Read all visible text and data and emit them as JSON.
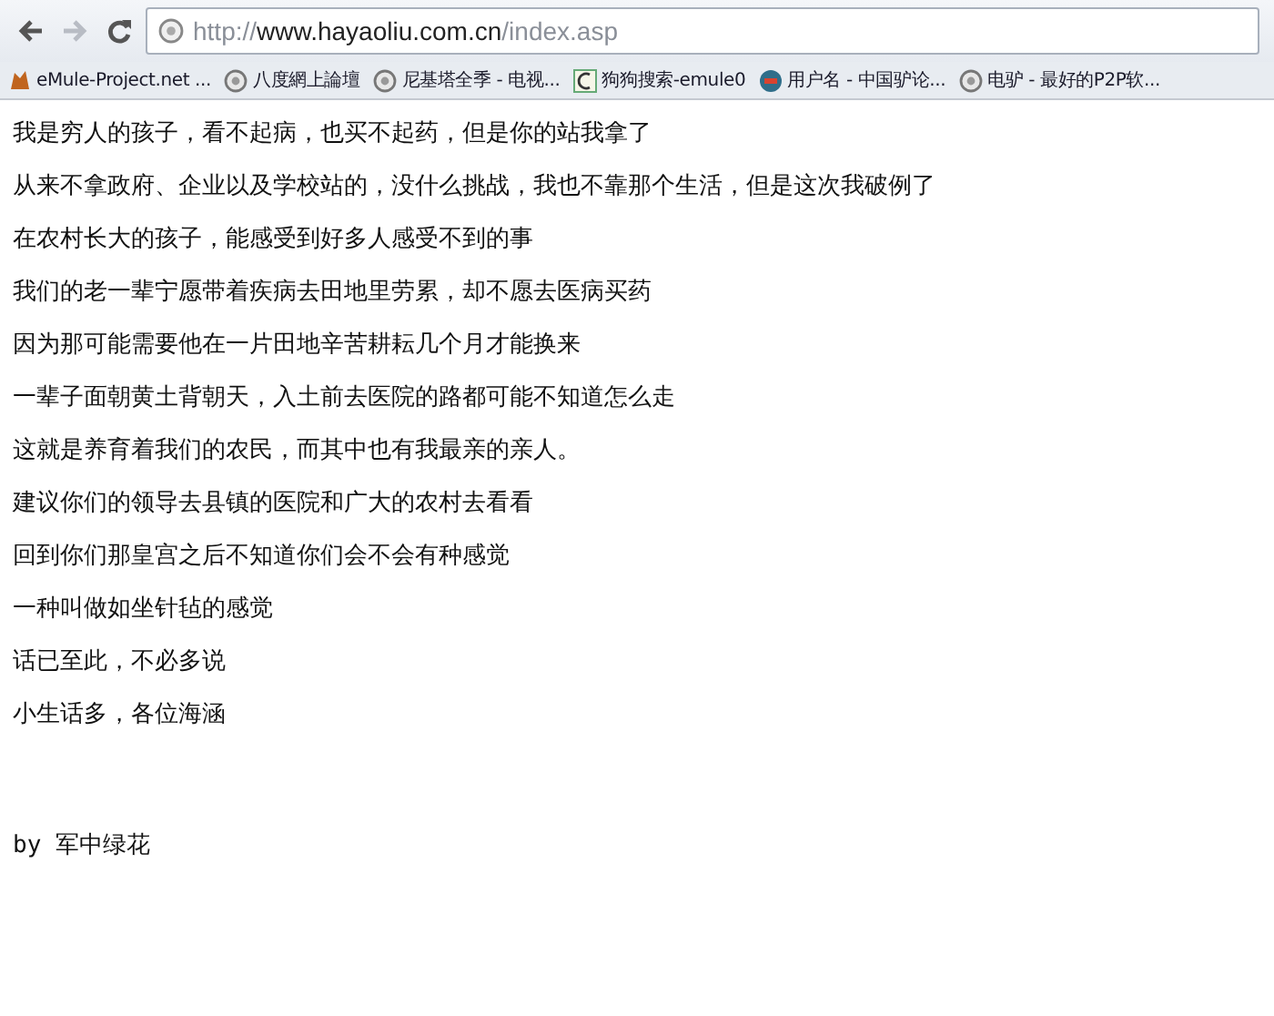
{
  "toolbar": {
    "back_disabled": false,
    "forward_disabled": true,
    "url": {
      "scheme": "http://",
      "host": "www.hayaoliu.com.cn",
      "path": "/index.asp"
    }
  },
  "bookmarks": [
    {
      "label": "eMule-Project.net ...",
      "kind": "mule"
    },
    {
      "label": "八度網上論壇",
      "kind": "globe"
    },
    {
      "label": "尼基塔全季 - 电视...",
      "kind": "globe"
    },
    {
      "label": "狗狗搜索-emule0",
      "kind": "page"
    },
    {
      "label": "用户名 - 中国驴论...",
      "kind": "forum"
    },
    {
      "label": "电驴 - 最好的P2P软...",
      "kind": "globe"
    }
  ],
  "lines": [
    "我是穷人的孩子，看不起病，也买不起药，但是你的站我拿了",
    "从来不拿政府、企业以及学校站的，没什么挑战，我也不靠那个生活，但是这次我破例了",
    "在农村长大的孩子，能感受到好多人感受不到的事",
    "我们的老一辈宁愿带着疾病去田地里劳累，却不愿去医病买药",
    "因为那可能需要他在一片田地辛苦耕耘几个月才能换来",
    "一辈子面朝黄土背朝天，入土前去医院的路都可能不知道怎么走",
    "这就是养育着我们的农民，而其中也有我最亲的亲人。",
    "建议你们的领导去县镇的医院和广大的农村去看看",
    "回到你们那皇宫之后不知道你们会不会有种感觉",
    "一种叫做如坐针毡的感觉",
    "话已至此，不必多说",
    "小生话多，各位海涵"
  ],
  "signature": "by 军中绿花"
}
